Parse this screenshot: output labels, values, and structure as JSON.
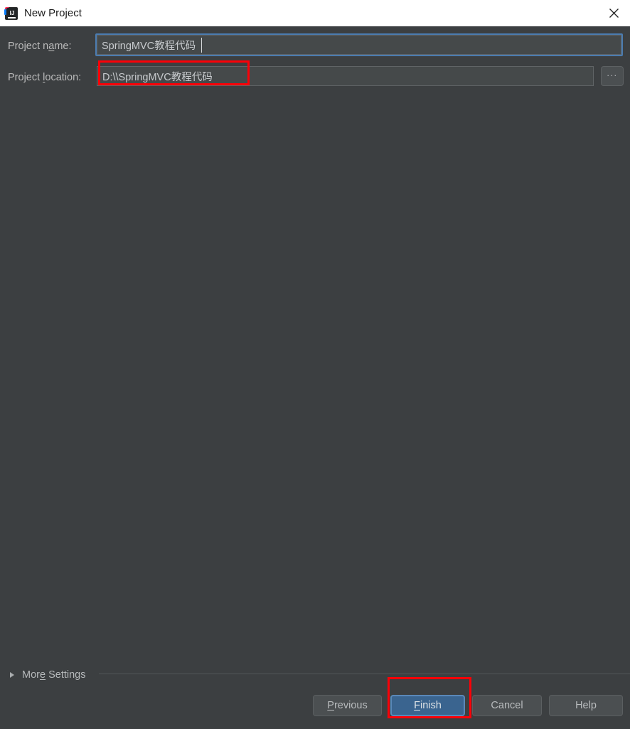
{
  "window": {
    "title": "New Project",
    "app_icon": "intellij-idea-icon",
    "close_icon": "close-icon"
  },
  "form": {
    "name_field": {
      "label_pre": "Project n",
      "label_mnemonic": "a",
      "label_post": "me:",
      "value": "SpringMVC教程代码",
      "placeholder": ""
    },
    "location_field": {
      "label_pre": "Project ",
      "label_mnemonic": "l",
      "label_post": "ocation:",
      "value": "D:\\\\SpringMVC教程代码",
      "placeholder": "",
      "browse_label": "...",
      "browse_icon": "ellipsis-icon"
    }
  },
  "more_settings": {
    "label_pre": "Mor",
    "label_mnemonic": "e",
    "label_post": " Settings",
    "expanded": false,
    "chevron_icon": "triangle-right-icon"
  },
  "buttons": {
    "previous": {
      "pre": "",
      "mnemonic": "P",
      "post": "revious"
    },
    "finish": {
      "pre": "",
      "mnemonic": "F",
      "post": "inish",
      "is_default": true
    },
    "cancel": {
      "pre": "Cancel",
      "mnemonic": "",
      "post": ""
    },
    "help": {
      "pre": "Help",
      "mnemonic": "",
      "post": ""
    }
  },
  "colors": {
    "background": "#3c3f41",
    "titlebar": "#ffffff",
    "input_background": "#45494a",
    "focus_border": "#4b7cb0",
    "default_button": "#3a648f",
    "annotation": "#fb0007",
    "text": "#bbbbbb"
  }
}
